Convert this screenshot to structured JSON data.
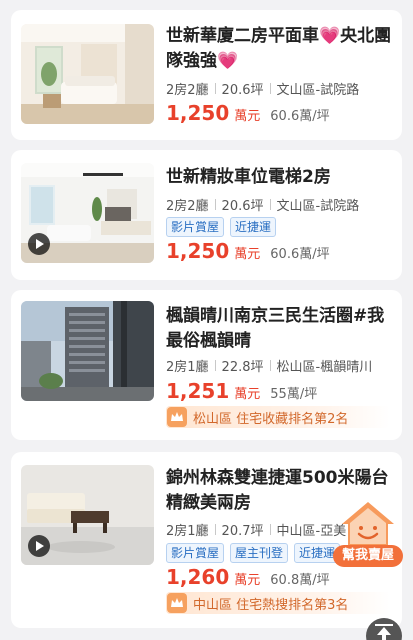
{
  "listings": [
    {
      "title": "世新華廈二房平面車💗央北團隊強強💗",
      "layout": "2房2廳",
      "size": "20.6坪",
      "location": "文山區-試院路",
      "tags": [],
      "price": "1,250",
      "price_unit": "萬元",
      "unit_price": "60.6萬/坪",
      "has_video": false,
      "rank_text": ""
    },
    {
      "title": "世新精妝車位電梯2房",
      "layout": "2房2廳",
      "size": "20.6坪",
      "location": "文山區-試院路",
      "tags": [
        "影片賞屋",
        "近捷運"
      ],
      "price": "1,250",
      "price_unit": "萬元",
      "unit_price": "60.6萬/坪",
      "has_video": true,
      "rank_text": ""
    },
    {
      "title": "楓韻晴川南京三民生活圈#我最俗楓韻晴",
      "layout": "2房1廳",
      "size": "22.8坪",
      "location": "松山區-楓韻晴川",
      "tags": [],
      "price": "1,251",
      "price_unit": "萬元",
      "unit_price": "55萬/坪",
      "has_video": false,
      "rank_text": "松山區 住宅收藏排名第2名"
    },
    {
      "title": "錦州林森雙連捷運500米陽台精緻美兩房",
      "layout": "2房1廳",
      "size": "20.7坪",
      "location": "中山區-亞美",
      "tags": [
        "影片賞屋",
        "屋主刊登",
        "近捷運"
      ],
      "price": "1,260",
      "price_unit": "萬元",
      "unit_price": "60.8萬/坪",
      "has_video": true,
      "rank_text": "中山區 住宅熱搜排名第3名"
    }
  ],
  "floating_button": {
    "label": "幫我賣屋",
    "icon": "house-smile-icon"
  },
  "back_to_top": {
    "icon": "arrow-up-icon"
  },
  "colors": {
    "price": "#e8412b",
    "tag": "#2a6fc2",
    "rank": "#d2682b",
    "accent": "#f2703a"
  }
}
